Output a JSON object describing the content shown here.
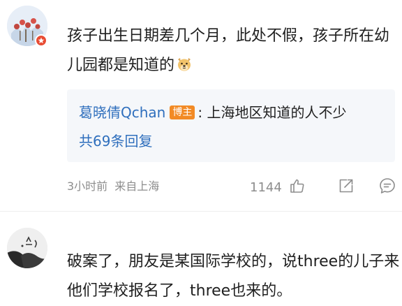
{
  "comments": [
    {
      "username": "",
      "text": "孩子出生日期差几个月，此处不假，孩子所在幼儿园都是知道的",
      "reply": {
        "author": "葛晓倩Qchan",
        "badge": "博主",
        "separator": ":",
        "text": "上海地区知道的人不少",
        "count_label": "共69条回复"
      },
      "time": "3小时前",
      "source": "来自上海",
      "likes": "1144"
    },
    {
      "username": "",
      "text": "破案了，朋友是某国际学校的，说three的儿子来他们学校报名了，three也来的。"
    }
  ],
  "icons": {
    "like": "thumb-up-icon",
    "share": "share-icon",
    "comment": "comment-icon",
    "vip": "vip-badge-icon",
    "emoji": "doge-emoji"
  },
  "colors": {
    "reply_author": "#2f6fbd",
    "badge": "#f28a25",
    "vip_badge": "#e84b33",
    "meta": "#8d8d8d",
    "reply_bg": "#f5f7fa"
  }
}
